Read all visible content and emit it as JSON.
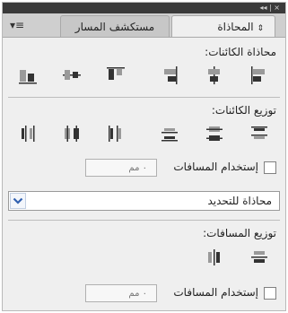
{
  "window": {
    "controls": "◂◂ | ×",
    "menu_icon": "panel-menu-icon"
  },
  "tabs": [
    {
      "label": "المحاذاة",
      "active": true
    },
    {
      "label": "مستكشف المسار",
      "active": false
    }
  ],
  "align_objects": {
    "title": "محاذاة الكائنات:"
  },
  "distribute_objects": {
    "title": "توزيع الكائنات:",
    "use_spacing_label": "إستخدام المسافات",
    "spacing_placeholder": "٠ مم"
  },
  "align_to": {
    "selected": "محاذاة للتحديد"
  },
  "distribute_spacing": {
    "title": "توزيع المسافات:",
    "use_spacing_label": "إستخدام المسافات",
    "spacing_placeholder": "٠ مم"
  },
  "colors": {
    "titlebar": "#3a3a3a",
    "panel": "#efefef",
    "icon_dark": "#333333",
    "icon_light": "#9a9a9a",
    "accent": "#3060b0"
  }
}
